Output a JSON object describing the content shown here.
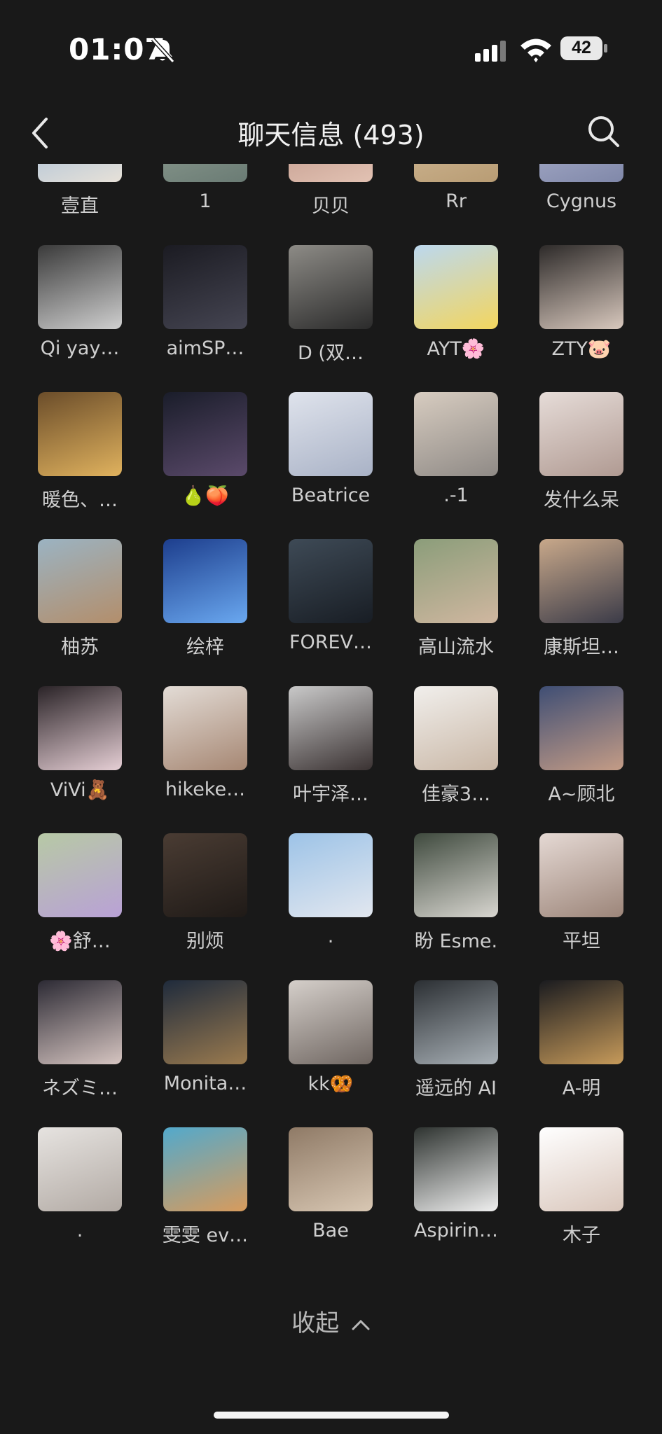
{
  "status": {
    "time": "01:07",
    "battery": "42"
  },
  "header": {
    "title": "聊天信息 (493)"
  },
  "members": [
    {
      "name": "壹直",
      "c1": "#8fb3d9",
      "c2": "#e7e1d8"
    },
    {
      "name": "1",
      "c1": "#9aa89b",
      "c2": "#6a7b74"
    },
    {
      "name": "贝贝",
      "c1": "#b58a7d",
      "c2": "#e2c2b3"
    },
    {
      "name": "Rr",
      "c1": "#d9c2a0",
      "c2": "#b89c74"
    },
    {
      "name": "Cygnus",
      "c1": "#b9bdd8",
      "c2": "#8088a9"
    },
    {
      "name": "Qi  yay…",
      "c1": "#3a3a3a",
      "c2": "#cfcfcf"
    },
    {
      "name": "aimSP…",
      "c1": "#1b1b22",
      "c2": "#454552"
    },
    {
      "name": "D (双…",
      "c1": "#8d8b86",
      "c2": "#2b2b2b"
    },
    {
      "name": "AYT🌸",
      "c1": "#bcd8ef",
      "c2": "#f3d65e"
    },
    {
      "name": "ZTY🐷",
      "c1": "#2d2a29",
      "c2": "#d8c8bd"
    },
    {
      "name": "暖色、…",
      "c1": "#6b4d2a",
      "c2": "#e0b25e"
    },
    {
      "name": "🍐🍑",
      "c1": "#1a1d2a",
      "c2": "#5b4a6b"
    },
    {
      "name": "Beatrice",
      "c1": "#dfe3ec",
      "c2": "#a9b2c6"
    },
    {
      "name": ".-1",
      "c1": "#d7ccc0",
      "c2": "#8f8a86"
    },
    {
      "name": "发什么呆",
      "c1": "#e6dcd8",
      "c2": "#b09a92"
    },
    {
      "name": "柚苏",
      "c1": "#9bb3c2",
      "c2": "#b38e6b"
    },
    {
      "name": "绘梓",
      "c1": "#1d3e8d",
      "c2": "#6aa8f0"
    },
    {
      "name": "FOREV…",
      "c1": "#3e4a56",
      "c2": "#181d24"
    },
    {
      "name": "高山流水",
      "c1": "#8b9d7a",
      "c2": "#d0b7a0"
    },
    {
      "name": "康斯坦…",
      "c1": "#c8a88a",
      "c2": "#3b3b48"
    },
    {
      "name": "ViVi🧸",
      "c1": "#2a2327",
      "c2": "#e6cfd5"
    },
    {
      "name": "hikeke…",
      "c1": "#e3dcd6",
      "c2": "#a68773"
    },
    {
      "name": "叶宇泽…",
      "c1": "#c9c9c9",
      "c2": "#3a3232"
    },
    {
      "name": "佳豪3…",
      "c1": "#f1efec",
      "c2": "#c9b7a6"
    },
    {
      "name": "A~顾北",
      "c1": "#3f4e74",
      "c2": "#c49c86"
    },
    {
      "name": "🌸舒…",
      "c1": "#b7c9a5",
      "c2": "#b9a1d6"
    },
    {
      "name": "别烦",
      "c1": "#4a3c33",
      "c2": "#1f1a17"
    },
    {
      "name": ".",
      "c1": "#9dc3e7",
      "c2": "#e2e7ef"
    },
    {
      "name": "盼 Esme.",
      "c1": "#3f4a3e",
      "c2": "#d8d6d0"
    },
    {
      "name": "平坦",
      "c1": "#e5d9d4",
      "c2": "#9c8579"
    },
    {
      "name": "ネズミ…",
      "c1": "#2c2a34",
      "c2": "#d6c5c1"
    },
    {
      "name": "Monita…",
      "c1": "#1f2b3c",
      "c2": "#9b7b4f"
    },
    {
      "name": "kk🥨",
      "c1": "#d5cfca",
      "c2": "#6f6661"
    },
    {
      "name": "遥远的 AI",
      "c1": "#2b2f33",
      "c2": "#a9b1b7"
    },
    {
      "name": "A-明",
      "c1": "#1a1b1f",
      "c2": "#c69a5a"
    },
    {
      "name": ".",
      "c1": "#e6e3e0",
      "c2": "#b2aaa4"
    },
    {
      "name": "雯雯 ev…",
      "c1": "#52a9cc",
      "c2": "#d89b5c"
    },
    {
      "name": "Bae",
      "c1": "#8f7a66",
      "c2": "#d8c7b3"
    },
    {
      "name": "Aspirin…",
      "c1": "#2e3330",
      "c2": "#f0f0f0"
    },
    {
      "name": "木子",
      "c1": "#ffffff",
      "c2": "#d9c6bb"
    }
  ],
  "footer": {
    "collapse_label": "收起"
  }
}
